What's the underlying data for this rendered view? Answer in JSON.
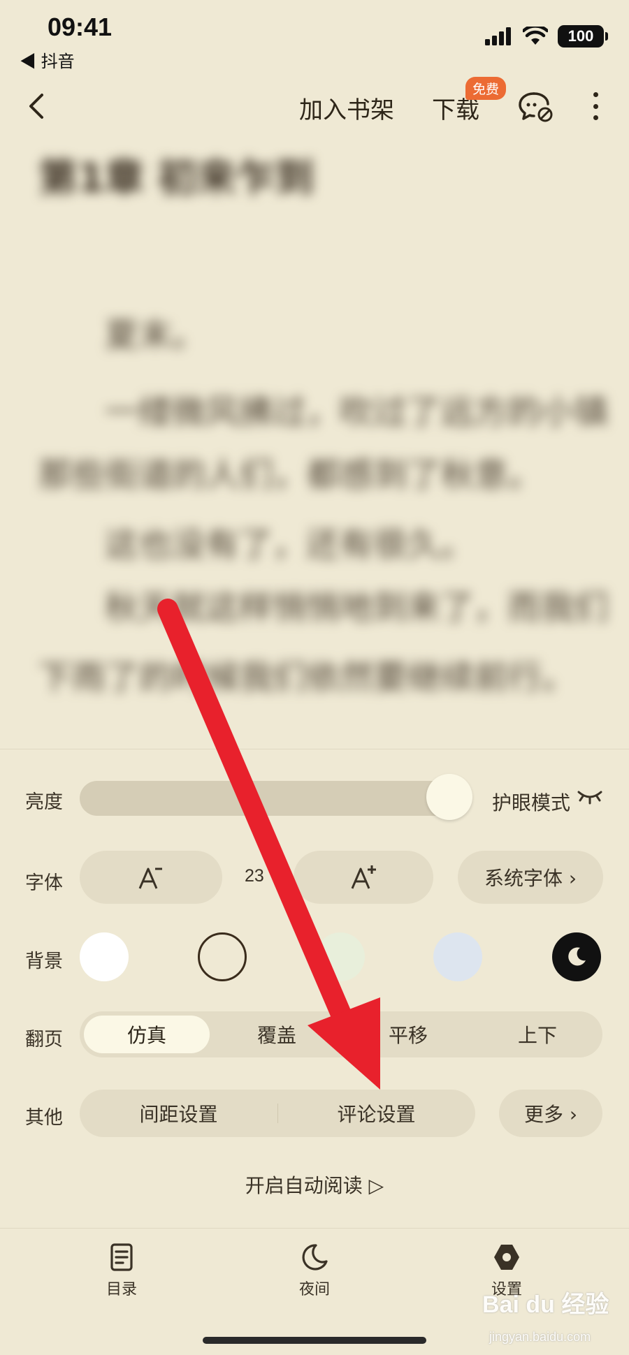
{
  "status": {
    "time": "09:41",
    "back_app": "◀ 抖音",
    "battery": "100"
  },
  "nav": {
    "add_shelf": "加入书架",
    "download": "下载",
    "free_badge": "免费"
  },
  "reader": {
    "chapter_title": "第1章 初来乍到",
    "paragraphs": [
      "夏末。",
      "一缕微风拂过，吹过了远方的小镇",
      "那些街道的人们，都感到了秋意。",
      "这也没有了，还有很久。",
      "秋天就这样悄悄地到来了，而我们",
      "下雨了的时候我们依然要继续前行。"
    ]
  },
  "settings": {
    "brightness_label": "亮度",
    "eye_mode_label": "护眼模式",
    "font_label": "字体",
    "font_size_value": "23",
    "system_font_label": "系统字体 ›",
    "background_label": "背景",
    "page_turn_label": "翻页",
    "page_turn_options": [
      "仿真",
      "覆盖",
      "平移",
      "上下"
    ],
    "other_label": "其他",
    "spacing_setting": "间距设置",
    "comment_setting": "评论设置",
    "more_label": "更多 ›",
    "auto_read_label": "开启自动阅读 ▷",
    "brightness_level": 0.88,
    "background_colors": [
      "#ffffff",
      "#efe9d4",
      "#e8efdb",
      "#dde5ef",
      "#111111"
    ]
  },
  "tabs": {
    "toc": "目录",
    "night": "夜间",
    "settings": "设置"
  },
  "watermark": {
    "brand": "Bai du 经验",
    "url": "jingyan.baidu.com"
  }
}
